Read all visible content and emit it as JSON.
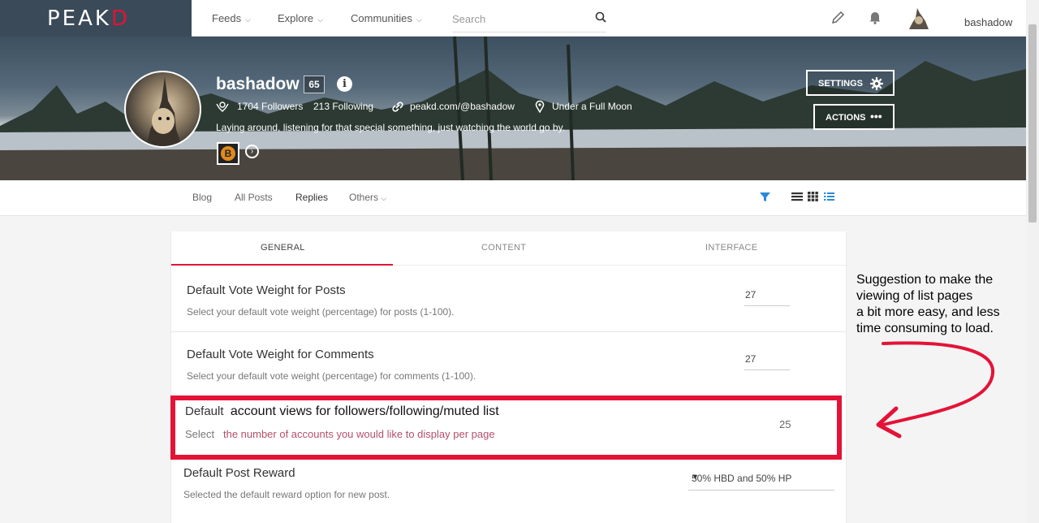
{
  "brand": {
    "logo_main": "PEAK",
    "logo_end": "D",
    "accent": "#e31337"
  },
  "topnav": {
    "items": [
      {
        "label": "Feeds"
      },
      {
        "label": "Explore"
      },
      {
        "label": "Communities"
      }
    ],
    "search_placeholder": "Search",
    "username": "bashadow"
  },
  "profile": {
    "name": "bashadow",
    "reputation": "65",
    "followers": "1704 Followers",
    "following": "213 Following",
    "link": "peakd.com/@bashadow",
    "location": "Under a Full Moon",
    "bio": "Laying around, listening for that special something, just watching the world go by.",
    "badge_letter": "B",
    "settings_label": "SETTINGS",
    "actions_label": "ACTIONS"
  },
  "subnav": {
    "tabs": [
      {
        "label": "Blog"
      },
      {
        "label": "All Posts"
      },
      {
        "label": "Replies"
      },
      {
        "label": "Others"
      }
    ]
  },
  "settings": {
    "tabs": [
      {
        "label": "GENERAL"
      },
      {
        "label": "CONTENT"
      },
      {
        "label": "INTERFACE"
      }
    ],
    "rows": [
      {
        "title": "Default Vote Weight for Posts",
        "desc": "Select your default vote weight (percentage) for posts (1-100).",
        "value": "27"
      },
      {
        "title": "Default Vote Weight for Comments",
        "desc": "Select your default vote weight (percentage) for comments (1-100).",
        "value": "27"
      },
      {
        "title_prefix": "Default",
        "title_new": "account views for followers/following/muted list",
        "desc_prefix": "Select",
        "desc_new": "the number of accounts you would like to display per page",
        "value": "25"
      },
      {
        "title": "Default Post Reward",
        "desc": "Selected the default reward option for new post.",
        "value": "50% HBD and 50% HP"
      }
    ]
  },
  "annotation": {
    "lines": [
      "Suggestion to make the",
      "viewing of list pages",
      "a bit more easy, and less",
      "time consuming to load."
    ],
    "color": "#e31337"
  }
}
